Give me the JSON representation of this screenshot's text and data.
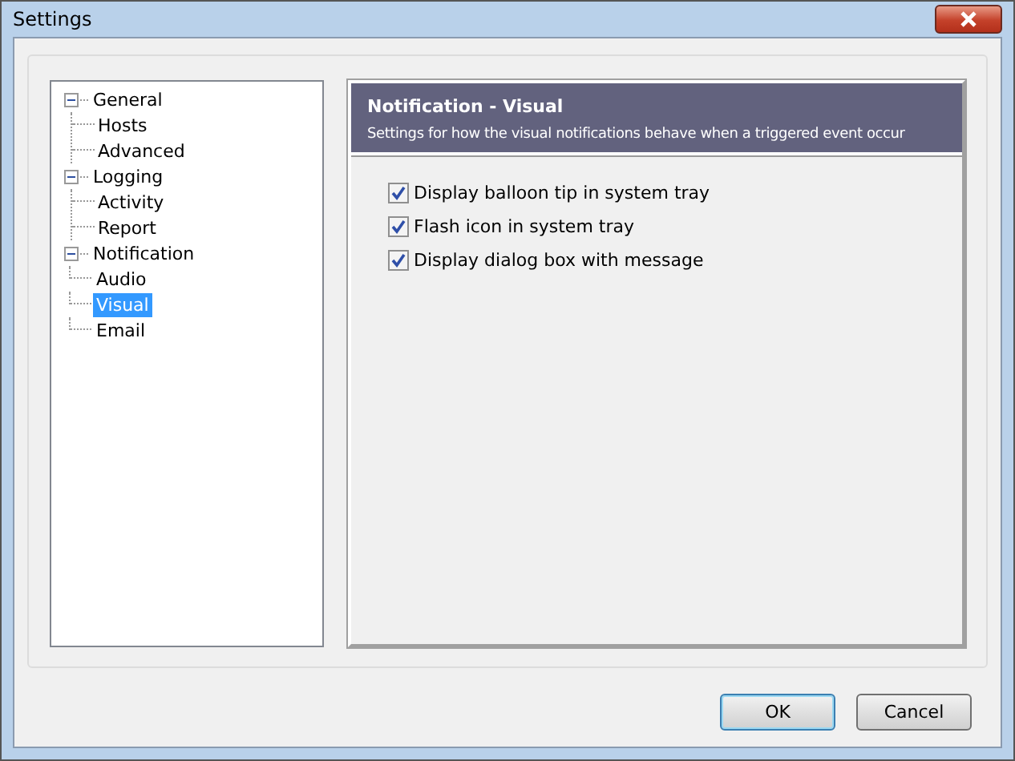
{
  "window": {
    "title": "Settings"
  },
  "tree": [
    {
      "label": "General",
      "expanded": true,
      "selected": false,
      "children": [
        {
          "label": "Hosts",
          "selected": false
        },
        {
          "label": "Advanced",
          "selected": false
        }
      ]
    },
    {
      "label": "Logging",
      "expanded": true,
      "selected": false,
      "children": [
        {
          "label": "Activity",
          "selected": false
        },
        {
          "label": "Report",
          "selected": false
        }
      ]
    },
    {
      "label": "Notification",
      "expanded": true,
      "selected": false,
      "children": [
        {
          "label": "Audio",
          "selected": false
        },
        {
          "label": "Visual",
          "selected": true
        },
        {
          "label": "Email",
          "selected": false
        }
      ]
    }
  ],
  "panel": {
    "title": "Notification - Visual",
    "description": "Settings for how the visual notifications behave when a triggered event occur",
    "options": [
      {
        "label": "Display balloon tip in system tray",
        "checked": true
      },
      {
        "label": "Flash icon in system tray",
        "checked": true
      },
      {
        "label": "Display dialog box with message",
        "checked": true
      }
    ]
  },
  "buttons": [
    {
      "label": "OK",
      "default": true
    },
    {
      "label": "Cancel",
      "default": false
    }
  ]
}
